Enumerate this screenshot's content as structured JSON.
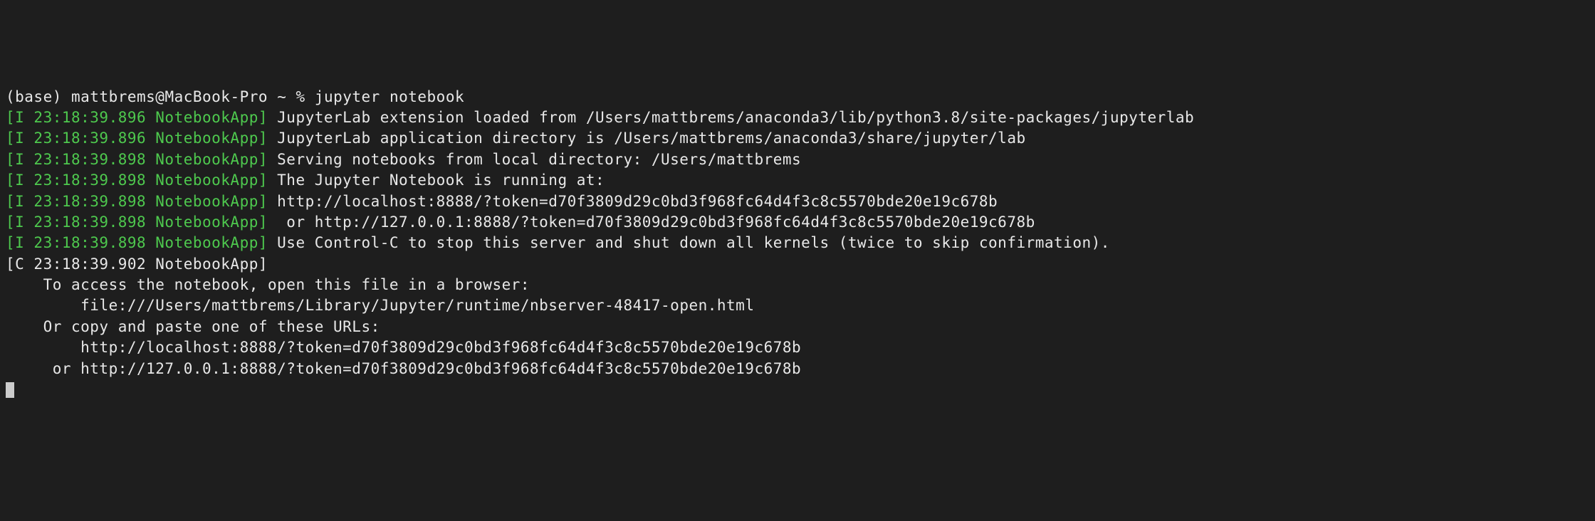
{
  "prompt": {
    "env": "(base)",
    "user_host": "mattbrems@MacBook-Pro",
    "cwd": "~",
    "symbol": "%",
    "command": "jupyter notebook"
  },
  "logs": [
    {
      "prefix": "[I 23:18:39.896 NotebookApp]",
      "prefix_color": "green",
      "message": " JupyterLab extension loaded from /Users/mattbrems/anaconda3/lib/python3.8/site-packages/jupyterlab"
    },
    {
      "prefix": "[I 23:18:39.896 NotebookApp]",
      "prefix_color": "green",
      "message": " JupyterLab application directory is /Users/mattbrems/anaconda3/share/jupyter/lab"
    },
    {
      "prefix": "[I 23:18:39.898 NotebookApp]",
      "prefix_color": "green",
      "message": " Serving notebooks from local directory: /Users/mattbrems"
    },
    {
      "prefix": "[I 23:18:39.898 NotebookApp]",
      "prefix_color": "green",
      "message": " The Jupyter Notebook is running at:"
    },
    {
      "prefix": "[I 23:18:39.898 NotebookApp]",
      "prefix_color": "green",
      "message": " http://localhost:8888/?token=d70f3809d29c0bd3f968fc64d4f3c8c5570bde20e19c678b"
    },
    {
      "prefix": "[I 23:18:39.898 NotebookApp]",
      "prefix_color": "green",
      "message": "  or http://127.0.0.1:8888/?token=d70f3809d29c0bd3f968fc64d4f3c8c5570bde20e19c678b"
    },
    {
      "prefix": "[I 23:18:39.898 NotebookApp]",
      "prefix_color": "green",
      "message": " Use Control-C to stop this server and shut down all kernels (twice to skip confirmation)."
    },
    {
      "prefix": "[C 23:18:39.902 NotebookApp]",
      "prefix_color": "white",
      "message": ""
    }
  ],
  "access_info": {
    "blank_line": "",
    "line1": "    To access the notebook, open this file in a browser:",
    "line2": "        file:///Users/mattbrems/Library/Jupyter/runtime/nbserver-48417-open.html",
    "line3": "    Or copy and paste one of these URLs:",
    "line4": "        http://localhost:8888/?token=d70f3809d29c0bd3f968fc64d4f3c8c5570bde20e19c678b",
    "line5": "     or http://127.0.0.1:8888/?token=d70f3809d29c0bd3f968fc64d4f3c8c5570bde20e19c678b"
  }
}
